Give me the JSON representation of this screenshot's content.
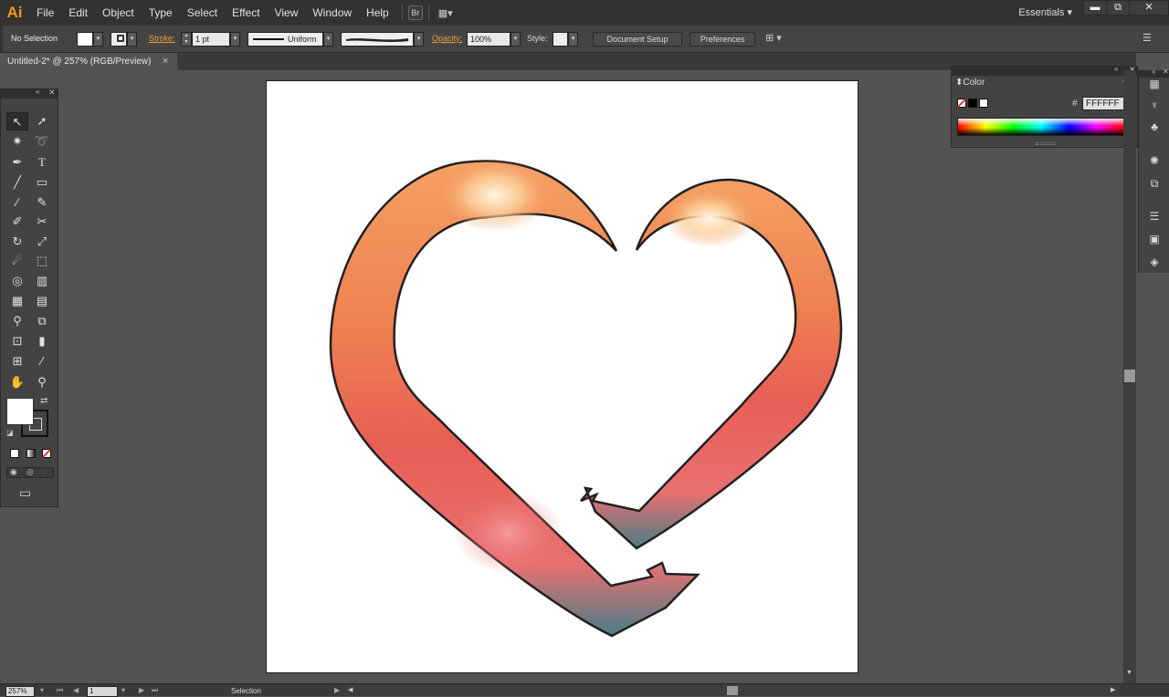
{
  "app": {
    "logo": "Ai"
  },
  "menu": [
    "File",
    "Edit",
    "Object",
    "Type",
    "Select",
    "Effect",
    "View",
    "Window",
    "Help"
  ],
  "menu_icons": {
    "bridge": "Br",
    "arrange": "▦▾"
  },
  "workspace": "Essentials",
  "window_buttons": {
    "minimize": "▬",
    "restore": "⧉",
    "close": "✕"
  },
  "control": {
    "selection": "No Selection",
    "stroke_label": "Stroke:",
    "stroke_weight": "1 pt",
    "profile": "Uniform",
    "opacity_label": "Opacity:",
    "opacity": "100%",
    "style_label": "Style:",
    "doc_setup": "Document Setup",
    "preferences": "Preferences"
  },
  "tab": {
    "title": "Untitled-2* @ 257% (RGB/Preview)",
    "close": "×"
  },
  "color_panel": {
    "title": "Color",
    "hash": "#",
    "hex": "FFFFFF"
  },
  "status": {
    "zoom": "257%",
    "page": "1",
    "tool": "Selection"
  },
  "colors": {
    "accent": "#f39c12",
    "stroke_label": "#e9a03b",
    "heart_outline": "#231f20"
  },
  "icons": {
    "tools": [
      "selection-icon",
      "direct-selection-icon",
      "magic-wand-icon",
      "lasso-icon",
      "pen-icon",
      "type-icon",
      "line-icon",
      "rectangle-icon",
      "paintbrush-icon",
      "pencil-icon",
      "blob-brush-icon",
      "scissors-icon",
      "rotate-icon",
      "scale-icon",
      "warp-icon",
      "free-transform-icon",
      "shape-builder-icon",
      "perspective-grid-icon",
      "mesh-icon",
      "gradient-icon",
      "eyedropper-icon",
      "blend-icon",
      "symbol-sprayer-icon",
      "column-graph-icon",
      "artboard-icon",
      "slice-icon",
      "hand-icon",
      "zoom-icon"
    ]
  }
}
